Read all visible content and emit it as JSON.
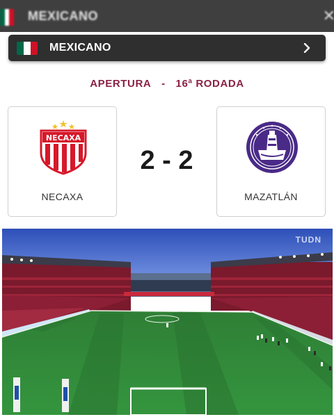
{
  "top_bar": {
    "title": "MEXICANO",
    "close_icon": "close-icon"
  },
  "league": {
    "flag_colors": [
      "#006847",
      "#ffffff",
      "#ce1126"
    ],
    "label": "MEXICANO",
    "icon": "chevron-right-icon"
  },
  "round": {
    "tournament": "APERTURA",
    "separator": "-",
    "matchday": "16ª RODADA"
  },
  "match": {
    "home": {
      "name": "NECAXA",
      "crest_icon": "necaxa-crest-icon",
      "colors": [
        "#d7182a",
        "#ffffff",
        "#f1c232"
      ]
    },
    "score": "2 - 2",
    "away": {
      "name": "MAZATLÁN",
      "crest_icon": "mazatlan-crest-icon",
      "colors": [
        "#4a2a87",
        "#ffffff"
      ]
    }
  },
  "media": {
    "image": "stadium-highlight-image",
    "watermark": "TUDN",
    "colors": {
      "sky": "#3d62c8",
      "pitch": "#2f8a3a",
      "stands": "#9a1e34"
    }
  }
}
